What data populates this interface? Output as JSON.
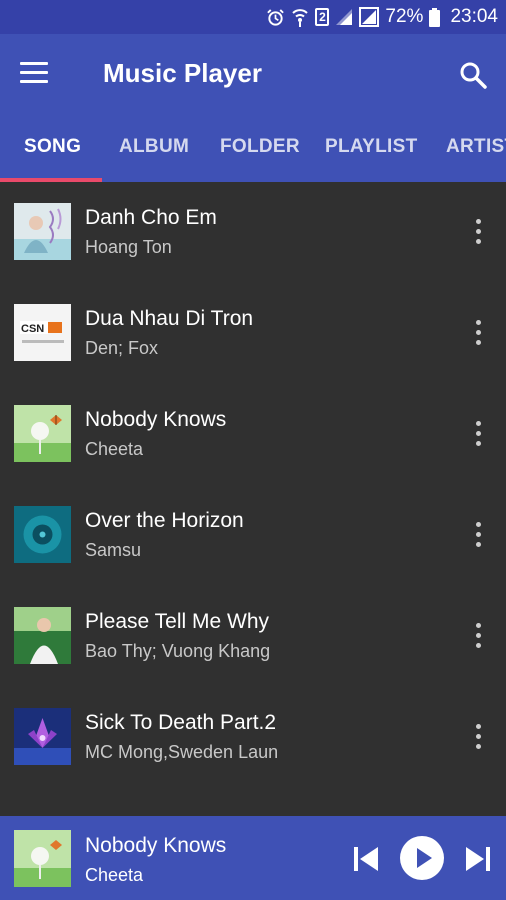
{
  "status_bar": {
    "battery_percent": "72%",
    "time": "23:04",
    "sim_slot": "2",
    "icons": [
      "alarm-icon",
      "wifi-icon",
      "sim-icon",
      "signal-icon",
      "signal-icon",
      "battery-icon"
    ]
  },
  "toolbar": {
    "title": "Music Player",
    "menu_icon": "hamburger-menu-icon",
    "search_icon": "search-icon"
  },
  "tabs": [
    {
      "label": "SONG",
      "active": true
    },
    {
      "label": "ALBUM",
      "active": false
    },
    {
      "label": "FOLDER",
      "active": false
    },
    {
      "label": "PLAYLIST",
      "active": false
    },
    {
      "label": "ARTIST",
      "active": false
    }
  ],
  "songs": [
    {
      "title": "Danh Cho Em",
      "artist": "Hoang Ton"
    },
    {
      "title": "Dua Nhau Di Tron",
      "artist": "Den; Fox"
    },
    {
      "title": "Nobody Knows",
      "artist": "Cheeta"
    },
    {
      "title": "Over the Horizon",
      "artist": "Samsung"
    },
    {
      "title": "Please Tell Me Why",
      "artist": "Bao Thy; Vuong Khang"
    },
    {
      "title": "Sick To Death Part.2",
      "artist": "MC Mong,Sweden Laundry"
    }
  ],
  "now_playing": {
    "title": "Nobody Knows",
    "artist": "Cheeta",
    "controls": [
      "skip-previous-icon",
      "play-icon",
      "skip-next-icon"
    ]
  },
  "colors": {
    "status_bar": "#3541a8",
    "primary": "#3f51b5",
    "accent": "#e94a6a",
    "list_background": "#303030"
  }
}
